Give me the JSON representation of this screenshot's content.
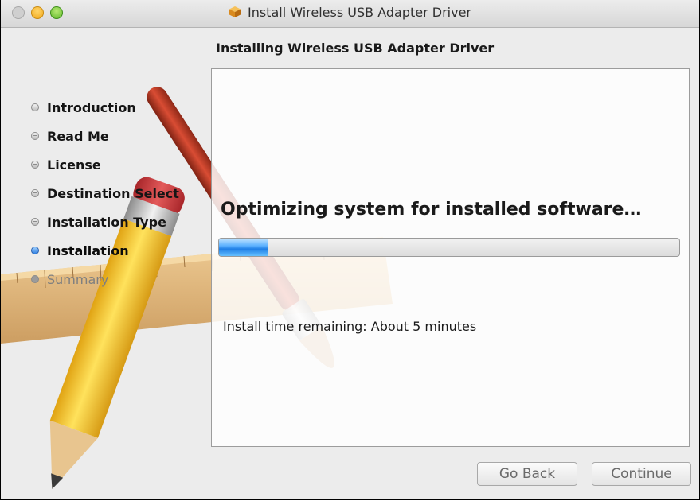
{
  "window": {
    "title": "Install Wireless USB Adapter Driver"
  },
  "heading": "Installing Wireless USB Adapter Driver",
  "sidebar": {
    "steps": [
      {
        "label": "Introduction",
        "state": "done"
      },
      {
        "label": "Read Me",
        "state": "done"
      },
      {
        "label": "License",
        "state": "done"
      },
      {
        "label": "Destination Select",
        "state": "done"
      },
      {
        "label": "Installation Type",
        "state": "done"
      },
      {
        "label": "Installation",
        "state": "active"
      },
      {
        "label": "Summary",
        "state": "pending"
      }
    ]
  },
  "content": {
    "status_text": "Optimizing system for installed software…",
    "progress_fraction": 0.105,
    "time_remaining": "Install time remaining: About 5 minutes"
  },
  "buttons": {
    "go_back": "Go Back",
    "continue": "Continue"
  },
  "icons": {
    "title": "package-icon"
  },
  "colors": {
    "accent": "#1f7fe6"
  }
}
